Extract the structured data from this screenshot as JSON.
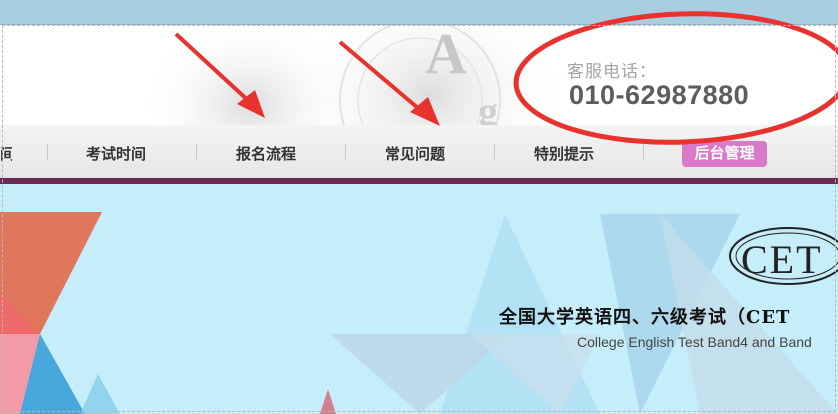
{
  "header": {
    "phone_label": "客服电话：",
    "phone_number": "010-62987880"
  },
  "nav": {
    "partial_item": "间",
    "items": [
      "考试时间",
      "报名流程",
      "常见问题",
      "特别提示"
    ],
    "admin_label": "后台管理"
  },
  "banner": {
    "logo_text": "CET",
    "title": "全国大学英语四、六级考试（CET",
    "subtitle": "College English Test Band4 and Band"
  },
  "colors": {
    "nav_accent": "#6e2a56",
    "admin_button": "#d87ac8",
    "annotation": "#e8322e",
    "banner_bg": "#c6eefa"
  }
}
